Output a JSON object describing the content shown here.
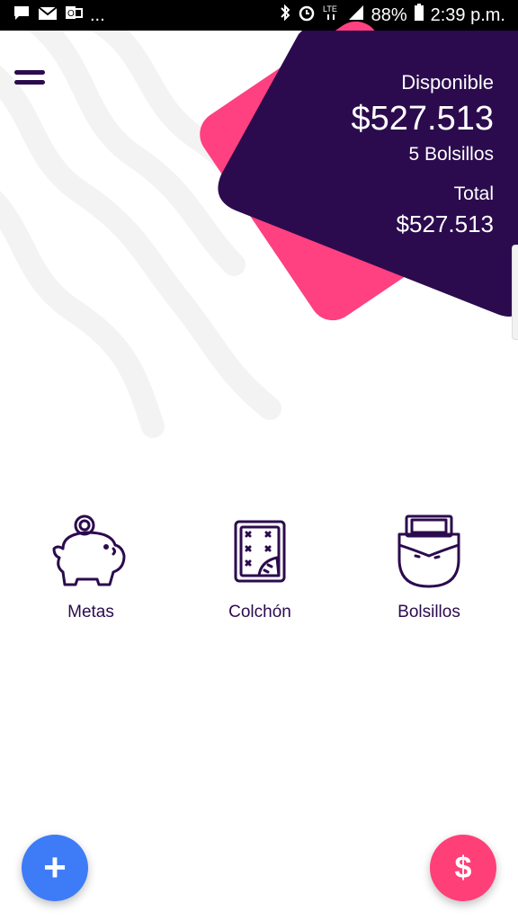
{
  "status_bar": {
    "left_icons": [
      "message-icon",
      "mail-icon",
      "outlook-icon"
    ],
    "more": "...",
    "right_icons": [
      "bluetooth-icon",
      "alarm-icon",
      "lte-icon",
      "signal-icon"
    ],
    "battery": "88%",
    "time": "2:39 p.m."
  },
  "summary": {
    "available_label": "Disponible",
    "available_amount": "$527.513",
    "pockets_count": "5 Bolsillos",
    "total_label": "Total",
    "total_amount": "$527.513"
  },
  "menu": [
    {
      "label": "Metas",
      "icon": "piggy-bank-icon"
    },
    {
      "label": "Colchón",
      "icon": "mattress-icon"
    },
    {
      "label": "Bolsillos",
      "icon": "pocket-icon"
    }
  ],
  "fabs": {
    "add_symbol": "+",
    "money_symbol": "$"
  },
  "colors": {
    "brand_dark": "#2b0b4e",
    "card_pink": "#ff4081",
    "fab_blue": "#3d7cf6",
    "fab_pink": "#ff3f78"
  }
}
